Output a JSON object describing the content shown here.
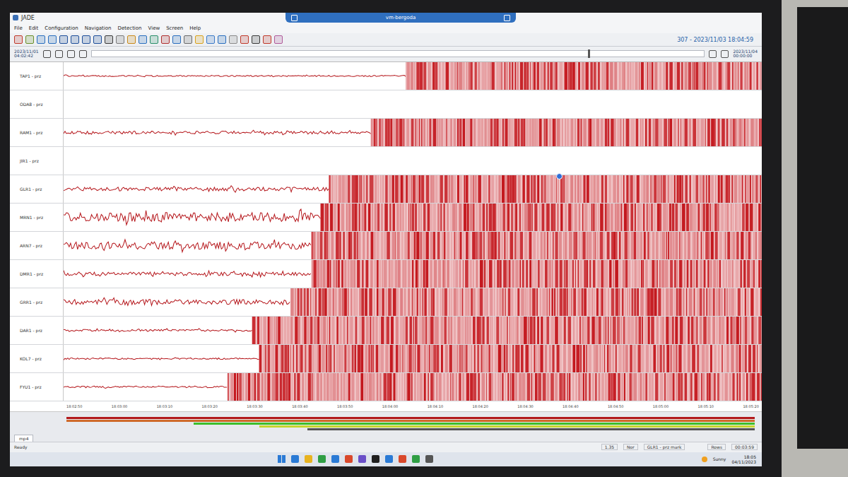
{
  "window": {
    "app": "JADE",
    "session": "vm-bergoda"
  },
  "menu": [
    "File",
    "Edit",
    "Configuration",
    "Navigation",
    "Detection",
    "View",
    "Screen",
    "Help"
  ],
  "toolbar": {
    "clock": "307 - 2023/11/03 18:04:59"
  },
  "navigation": {
    "start_date": "2023/11/01",
    "start_time": "04:02:42",
    "end_date": "2023/11/04",
    "end_time": "00:00:00",
    "scroll": {
      "level": 0.81
    }
  },
  "channels": [
    {
      "name": "TAP1 - prz",
      "signal": true,
      "onset": 0.49,
      "noise": 0.05,
      "marker": null
    },
    {
      "name": "ODA8 - prz",
      "signal": false,
      "onset": 1,
      "noise": 0,
      "marker": null
    },
    {
      "name": "RAM1 - prz",
      "signal": true,
      "onset": 0.44,
      "noise": 0.12,
      "marker": null
    },
    {
      "name": "JIR1 - prz",
      "signal": false,
      "onset": 1,
      "noise": 0,
      "marker": null
    },
    {
      "name": "GLR1 - prz",
      "signal": true,
      "onset": 0.38,
      "noise": 0.15,
      "marker": 0.71
    },
    {
      "name": "MRN1 - prz",
      "signal": true,
      "onset": 0.368,
      "noise": 0.38,
      "marker": null
    },
    {
      "name": "ARN7 - prz",
      "signal": true,
      "onset": 0.355,
      "noise": 0.3,
      "marker": null
    },
    {
      "name": "DMR1 - prz",
      "signal": true,
      "onset": 0.355,
      "noise": 0.15,
      "marker": null
    },
    {
      "name": "GRR1 - prz",
      "signal": true,
      "onset": 0.325,
      "noise": 0.22,
      "marker": null
    },
    {
      "name": "DAR1 - prz",
      "signal": true,
      "onset": 0.27,
      "noise": 0.08,
      "marker": null
    },
    {
      "name": "KOL7 - prz",
      "signal": true,
      "onset": 0.28,
      "noise": 0.06,
      "marker": null
    },
    {
      "name": "FYU1 - prz",
      "signal": true,
      "onset": 0.235,
      "noise": 0.07,
      "marker": null
    }
  ],
  "time_axis": [
    "18:02:50",
    "18:03:00",
    "18:03:10",
    "18:03:20",
    "18:03:30",
    "18:03:40",
    "18:03:50",
    "18:04:00",
    "18:04:10",
    "18:04:20",
    "18:04:30",
    "18:04:40",
    "18:04:50",
    "18:05:00",
    "18:05:10",
    "18:05:20"
  ],
  "timeline": [
    {
      "color": "#b3191b",
      "start": 0,
      "end": 1
    },
    {
      "color": "#cf6a2a",
      "start": 0,
      "end": 1
    },
    {
      "color": "#3cbf2b",
      "start": 0.185,
      "end": 1
    },
    {
      "color": "#c6d52b",
      "start": 0.28,
      "end": 1
    },
    {
      "color": "#555555",
      "start": 0.35,
      "end": 1
    }
  ],
  "doc_tab": "mp4",
  "status_bar": {
    "message": "Ready",
    "fields": [
      "1.35",
      "Nor",
      "GLR1 - prz mark"
    ],
    "right": [
      "Rows",
      "00:03:59"
    ]
  },
  "taskbar": {
    "weather": "Sunny",
    "time": "18:05",
    "date": "04/11/2023"
  }
}
